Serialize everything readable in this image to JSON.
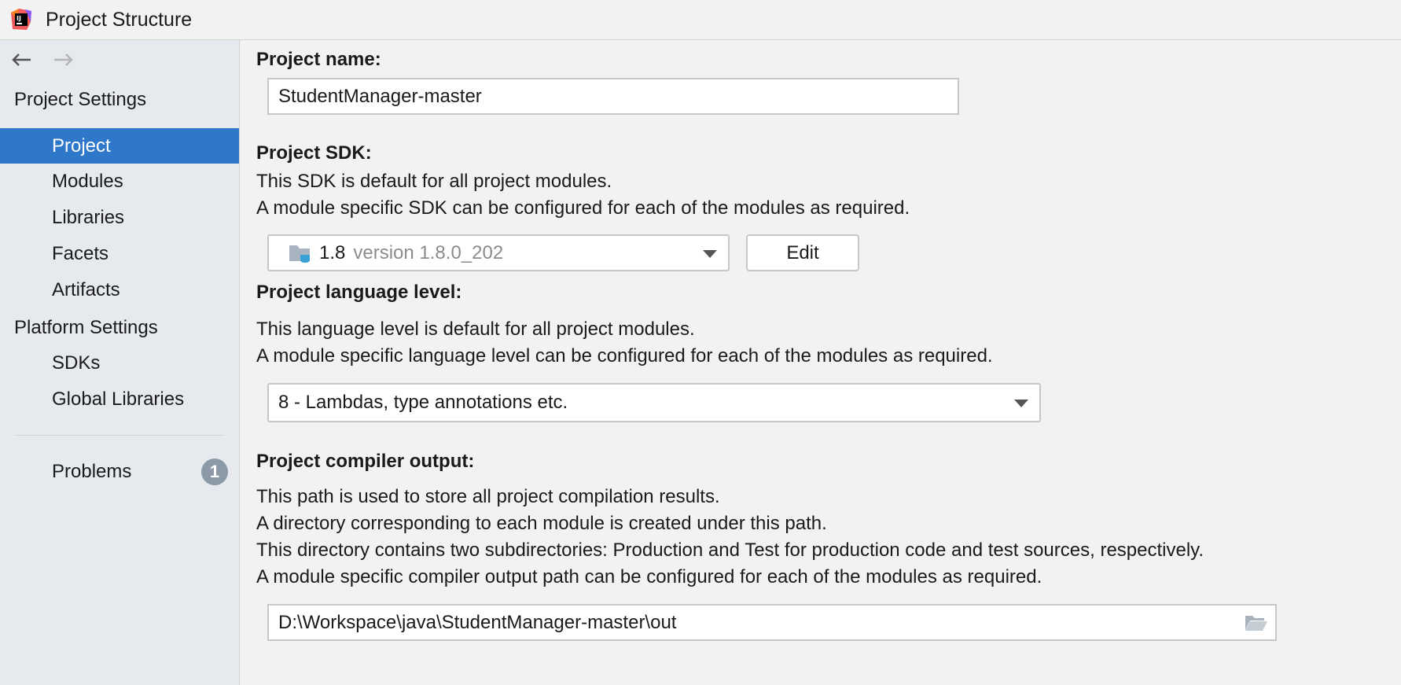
{
  "window": {
    "title": "Project Structure"
  },
  "sidebar": {
    "project_settings_label": "Project Settings",
    "project_items": [
      {
        "label": "Project"
      },
      {
        "label": "Modules"
      },
      {
        "label": "Libraries"
      },
      {
        "label": "Facets"
      },
      {
        "label": "Artifacts"
      }
    ],
    "platform_settings_label": "Platform Settings",
    "platform_items": [
      {
        "label": "SDKs"
      },
      {
        "label": "Global Libraries"
      }
    ],
    "problems": {
      "label": "Problems",
      "count": "1"
    }
  },
  "main": {
    "project_name": {
      "heading": "Project name:",
      "value": "StudentManager-master"
    },
    "project_sdk": {
      "heading": "Project SDK:",
      "desc_1": "This SDK is default for all project modules.",
      "desc_2": "A module specific SDK can be configured for each of the modules as required.",
      "sdk_name": "1.8",
      "sdk_version": "version 1.8.0_202",
      "edit_label": "Edit"
    },
    "language_level": {
      "heading": "Project language level:",
      "desc_1": "This language level is default for all project modules.",
      "desc_2": "A module specific language level can be configured for each of the modules as required.",
      "value": "8 - Lambdas, type annotations etc."
    },
    "compiler_output": {
      "heading": "Project compiler output:",
      "desc_1": "This path is used to store all project compilation results.",
      "desc_2": "A directory corresponding to each module is created under this path.",
      "desc_3": "This directory contains two subdirectories: Production and Test for production code and test sources, respectively.",
      "desc_4": "A module specific compiler output path can be configured for each of the modules as required.",
      "path": "D:\\Workspace\\java\\StudentManager-master\\out"
    }
  },
  "colors": {
    "selection": "#2f77c8",
    "sidebar_bg": "#e6e9ee",
    "badge": "#8c9aa8"
  }
}
